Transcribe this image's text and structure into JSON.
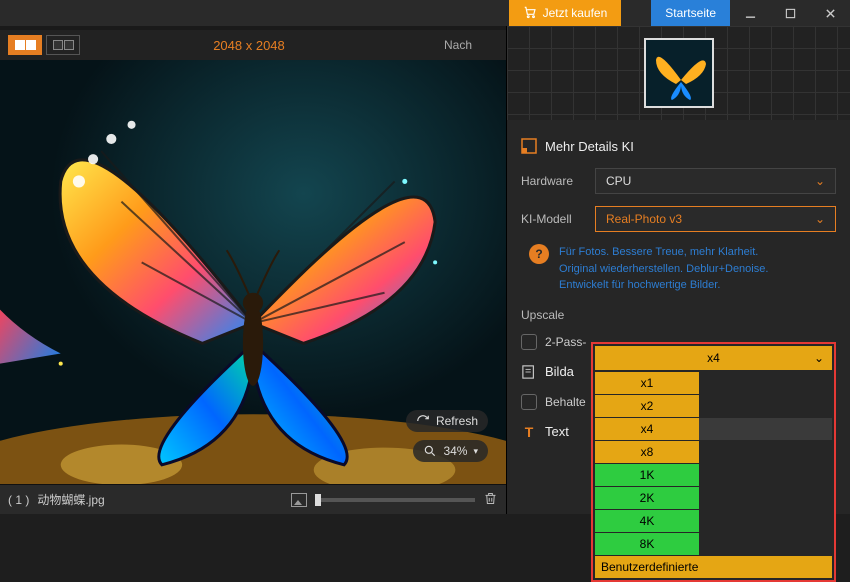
{
  "titlebar": {
    "buy": "Jetzt kaufen",
    "start": "Startseite"
  },
  "viewer": {
    "dimensions": "2048 x 2048",
    "after_label": "Nach",
    "refresh": "Refresh",
    "zoom": "34%"
  },
  "filmstrip": {
    "index": "( 1 )",
    "filename": "动物蝴蝶.jpg"
  },
  "panel": {
    "section_title": "Mehr Details KI",
    "hardware_label": "Hardware",
    "hardware_value": "CPU",
    "model_label": "KI-Modell",
    "model_value": "Real-Photo v3",
    "model_desc_l1": "Für Fotos. Bessere Treue, mehr Klarheit.",
    "model_desc_l2": "Original wiederherstellen. Deblur+Denoise.",
    "model_desc_l3": "Entwickelt für hochwertige Bilder.",
    "upscale_label": "Upscale",
    "twopass_label": "2-Pass-",
    "image_section": "Bilda",
    "keep_label": "Behalte",
    "text_section": "Text"
  },
  "upscale_dropdown": {
    "current": "x4",
    "options_orange": [
      "x1",
      "x2",
      "x4",
      "x8"
    ],
    "options_green": [
      "1K",
      "2K",
      "4K",
      "8K"
    ],
    "custom": "Benutzerdefinierte",
    "hovered": "x4"
  }
}
